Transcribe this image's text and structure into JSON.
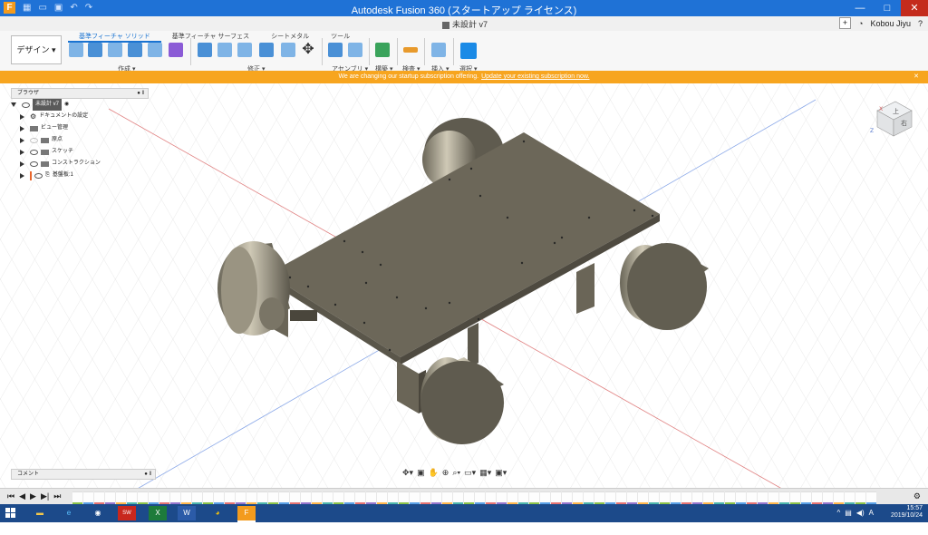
{
  "window": {
    "title": "Autodesk Fusion 360 (スタートアップ ライセンス)",
    "app_icon": "F",
    "minimize": "—",
    "maximize": "□",
    "close": "✕"
  },
  "document_tab": {
    "label": "未設計 v7",
    "plus": "+",
    "user": "Kobou Jiyu"
  },
  "toolbar": {
    "workspace": "デザイン ▾",
    "ribbon_tabs": [
      "基準フィーチャ ソリッド",
      "基準フィーチャ サーフェス",
      "シートメタル",
      "ツール"
    ],
    "groups": [
      "作成 ▾",
      "修正 ▾",
      "アセンブリ ▾",
      "構築 ▾",
      "検査 ▾",
      "挿入 ▾",
      "選択 ▾"
    ]
  },
  "banner": {
    "text": "We are changing our startup subscription offering.",
    "link": "Update your existing subscription now.",
    "close": "✕"
  },
  "browser": {
    "title": "ブラウザ",
    "root": "未設計 v7",
    "items": [
      "ドキュメントの設定",
      "ビュー管理",
      "原点",
      "スケッチ",
      "コンストラクション",
      "基盤板:1"
    ]
  },
  "comments": {
    "label": "コメント"
  },
  "viewcube": {
    "face_top": "上",
    "face_right": "右",
    "axis_x": "X",
    "axis_z": "Z"
  },
  "taskbar": {
    "time": "15:57",
    "date": "2019/10/24",
    "apps": [
      "folder",
      "ie",
      "search",
      "SW 2017",
      "excel",
      "word",
      "chrome",
      "fusion"
    ]
  },
  "colors": {
    "title_bar": "#1f72d6",
    "banner": "#f7a51f",
    "model_gray": "#6b6658",
    "taskbar": "#1c4a8a"
  }
}
